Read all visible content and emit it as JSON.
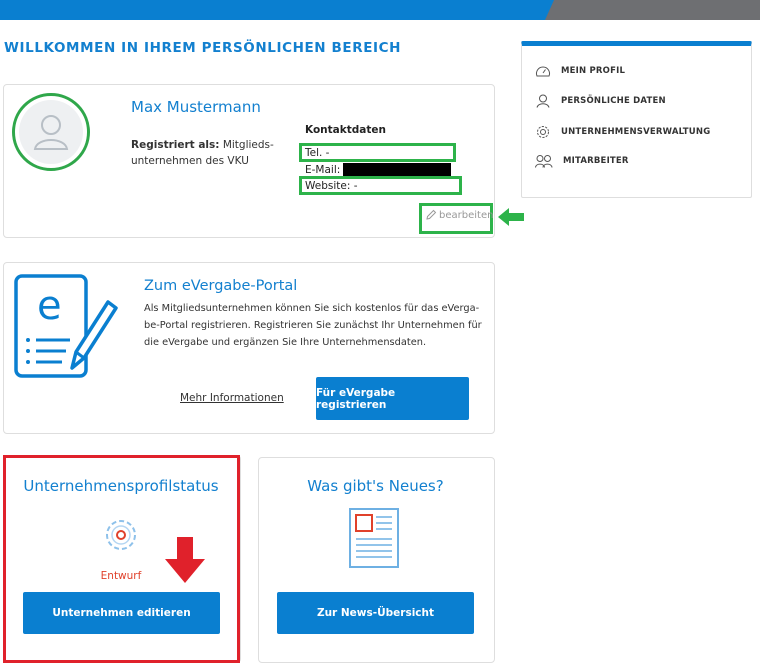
{
  "welcome": "WILLKOMMEN IN IHREM PERSÖNLICHEN BEREICH",
  "profile": {
    "name": "Max Mustermann",
    "registered_label": "Registriert als:",
    "registered_value_line1": "Mitglieds-",
    "registered_value_line2": "unternehmen des VKU",
    "contact_heading": "Kontaktdaten",
    "tel": "Tel. -",
    "email_label": "E-Mail:",
    "website": "Website: -",
    "edit_label": "bearbeiten"
  },
  "evergabe": {
    "title": "Zum eVergabe-Portal",
    "text_line1": "Als Mitgliedsunternehmen können Sie sich kostenlos für das eVerga-",
    "text_line2": "be-Portal registrieren. Registrieren Sie zunächst Ihr Unternehmen für",
    "text_line3": "die eVergabe und ergänzen Sie Ihre Unternehmensdaten.",
    "more_link": "Mehr Informationen",
    "register_button": "Für eVergabe registrieren"
  },
  "status_tile": {
    "title": "Unternehmensprofilstatus",
    "status": "Entwurf",
    "button": "Unternehmen editieren"
  },
  "news_tile": {
    "title": "Was gibt's Neues?",
    "button": "Zur News-Übersicht"
  },
  "sidebar": {
    "items": [
      {
        "label": "MEIN PROFIL",
        "icon": "gauge-icon"
      },
      {
        "label": "PERSÖNLICHE DATEN",
        "icon": "person-icon"
      },
      {
        "label": "UNTERNEHMENSVERWALTUNG",
        "icon": "gear-icon"
      },
      {
        "label": "MITARBEITER",
        "icon": "people-icon"
      }
    ]
  },
  "colors": {
    "accent": "#0a7fd0",
    "highlight_green": "#2db34a",
    "highlight_red": "#e0212b",
    "status_red": "#e0412b"
  }
}
